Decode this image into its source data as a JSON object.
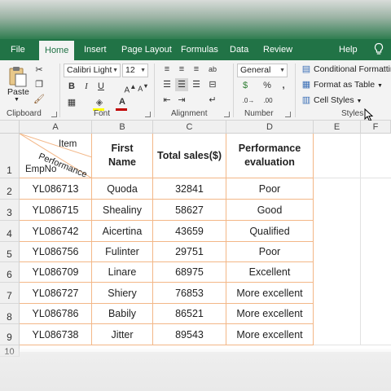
{
  "ribbon_tabs": [
    "File",
    "Home",
    "Insert",
    "Page Layout",
    "Formulas",
    "Data",
    "Review",
    "Help"
  ],
  "clipboard": {
    "paste_label": "Paste",
    "group_label": "Clipboard"
  },
  "font": {
    "name": "Calibri Light",
    "size": "12",
    "group_label": "Font"
  },
  "alignment": {
    "group_label": "Alignment"
  },
  "number": {
    "format": "General",
    "group_label": "Number"
  },
  "styles": {
    "conditional_formatting": "Conditional Formatting",
    "format_as_table": "Format as Table",
    "cell_styles": "Cell Styles",
    "group_label": "Styles"
  },
  "columns": [
    "A",
    "B",
    "C",
    "D",
    "E",
    "F"
  ],
  "rows": [
    "1",
    "2",
    "3",
    "4",
    "5",
    "6",
    "7",
    "8",
    "9",
    "10"
  ],
  "header_cell": {
    "item": "Item",
    "performance": "Performance",
    "empno": "EmpNo"
  },
  "headers": {
    "first_name": [
      "First",
      "Name"
    ],
    "total_sales": "Total sales($)",
    "evaluation": [
      "Performance",
      "evaluation"
    ]
  },
  "table": [
    [
      "YL086713",
      "Quoda",
      "32841",
      "Poor"
    ],
    [
      "YL086715",
      "Shealiny",
      "58627",
      "Good"
    ],
    [
      "YL086742",
      "Aicertina",
      "43659",
      "Qualified"
    ],
    [
      "YL086756",
      "Fulinter",
      "29751",
      "Poor"
    ],
    [
      "YL086709",
      "Linare",
      "68975",
      "Excellent"
    ],
    [
      "YL086727",
      "Shiery",
      "76853",
      "More excellent"
    ],
    [
      "YL086786",
      "Babily",
      "86521",
      "More excellent"
    ],
    [
      "YL086738",
      "Jitter",
      "89543",
      "More excellent"
    ]
  ],
  "colors": {
    "accent": "#217346",
    "border": "#f3b787",
    "font_red": "#c00000",
    "highlight_yellow": "#ffff00"
  }
}
